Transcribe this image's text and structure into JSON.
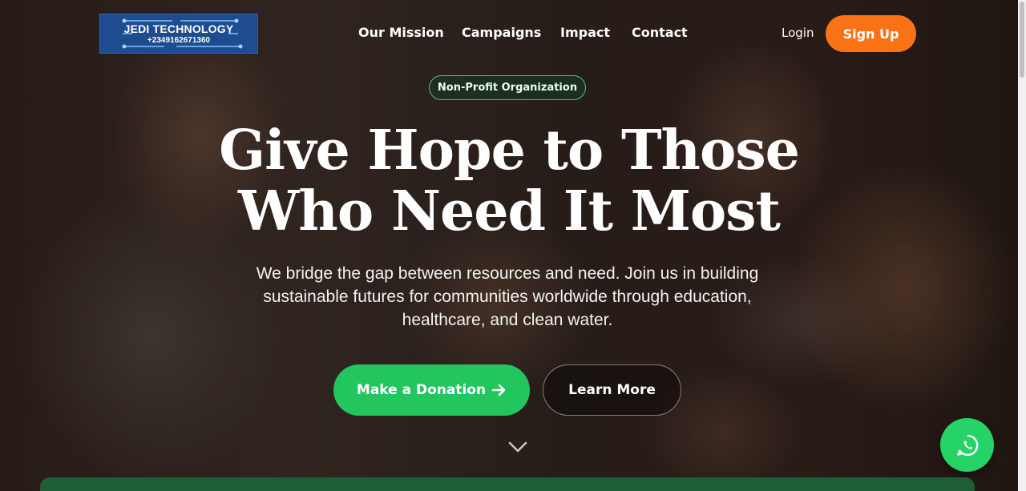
{
  "logo": {
    "name": "JEDI TECHNOLOGY",
    "phone": "+2349162671360",
    "bg_color": "#1f4b8f"
  },
  "nav": {
    "links": [
      "Our Mission",
      "Campaigns",
      "Impact",
      "Contact"
    ],
    "login": "Login",
    "signup": "Sign Up",
    "signup_color": "#f97316"
  },
  "hero": {
    "badge": "Non-Profit Organization",
    "headline_lines": [
      "Give Hope to Those",
      "Who Need It Most"
    ],
    "subtitle_lines": [
      "We bridge the gap between resources and need. Join us in building",
      "sustainable futures for communities worldwide through education,",
      "healthcare, and clean water."
    ],
    "primary_button": "Make a Donation",
    "primary_button_icon": "arrow-right-icon",
    "primary_color": "#22c55e",
    "secondary_button": "Learn More",
    "scroll_icon": "chevron-down-icon"
  },
  "floating": {
    "icon": "whatsapp-icon",
    "color": "#25d366"
  }
}
